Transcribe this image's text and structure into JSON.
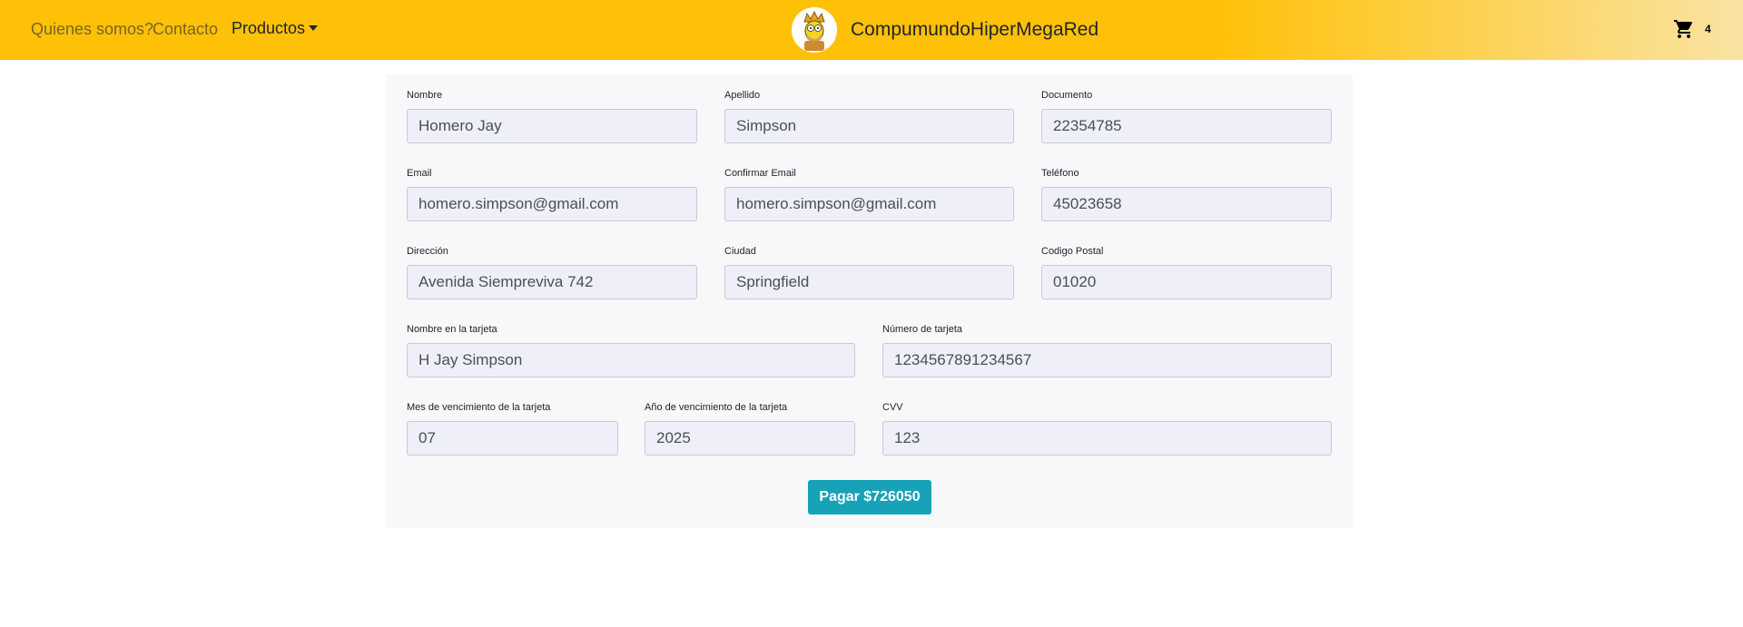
{
  "nav": {
    "quienes": "Quienes somos?",
    "contacto": "Contacto",
    "productos": "Productos"
  },
  "brand": {
    "name": "CompumundoHiperMegaRed",
    "logo_icon": "homer-king-avatar-icon"
  },
  "cart": {
    "icon": "shopping-cart-icon",
    "count": "4"
  },
  "form": {
    "nombre": {
      "label": "Nombre",
      "value": "Homero Jay"
    },
    "apellido": {
      "label": "Apellido",
      "value": "Simpson"
    },
    "documento": {
      "label": "Documento",
      "value": "22354785"
    },
    "email": {
      "label": "Email",
      "value": "homero.simpson@gmail.com"
    },
    "confirmar_email": {
      "label": "Confirmar Email",
      "value": "homero.simpson@gmail.com"
    },
    "telefono": {
      "label": "Teléfono",
      "value": "45023658"
    },
    "direccion": {
      "label": "Dirección",
      "value": "Avenida Siempreviva 742"
    },
    "ciudad": {
      "label": "Ciudad",
      "value": "Springfield"
    },
    "codigo_postal": {
      "label": "Codigo Postal",
      "value": "01020"
    },
    "nombre_tarjeta": {
      "label": "Nombre en la tarjeta",
      "value": "H Jay Simpson"
    },
    "numero_tarjeta": {
      "label": "Número de tarjeta",
      "value": "1234567891234567"
    },
    "mes_vencimiento": {
      "label": "Mes de vencimiento de la tarjeta",
      "value": "07"
    },
    "anio_vencimiento": {
      "label": "Año de vencimiento de la tarjeta",
      "value": "2025"
    },
    "cvv": {
      "label": "CVV",
      "value": "123"
    }
  },
  "pay_button": "Pagar $726050",
  "colors": {
    "navbar": "#ffc107",
    "button": "#17a2b8",
    "input_bg": "#efeffa"
  }
}
